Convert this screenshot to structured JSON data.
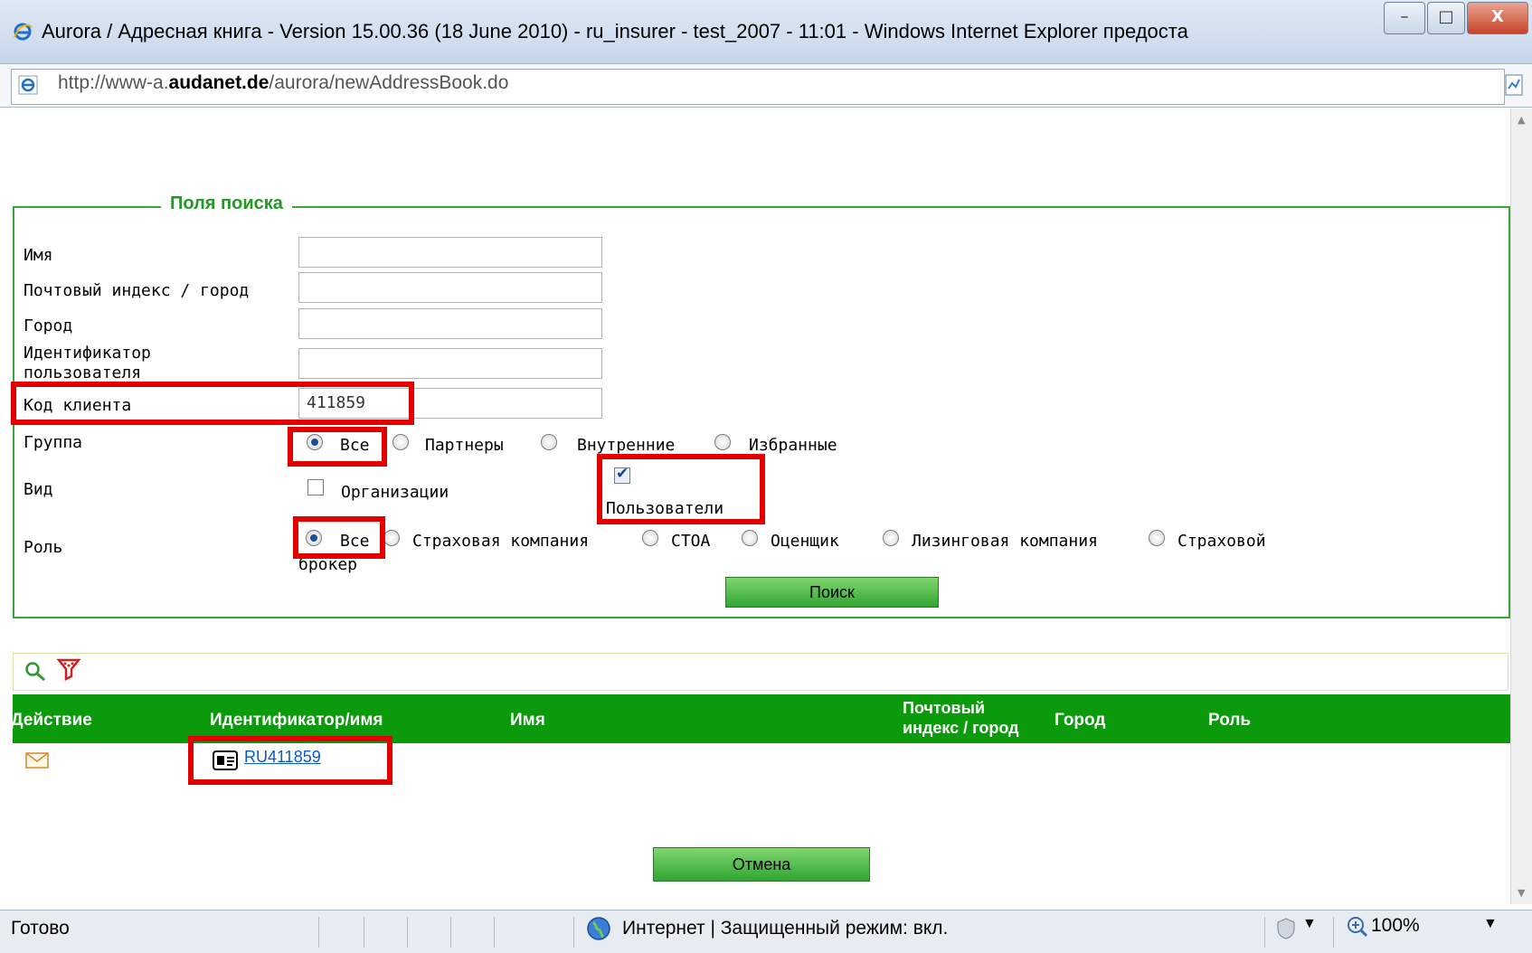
{
  "window": {
    "title": "Aurora / Адресная книга - Version 15.00.36 (18 June 2010) - ru_insurer - test_2007 - 11:01 - Windows Internet Explorer предоста",
    "minimize_label": "–",
    "maximize_label": "□",
    "close_label": "X"
  },
  "address": {
    "url_prefix": "http://www-a.",
    "url_domain": "audanet.de",
    "url_path": "/aurora/newAddressBook.do"
  },
  "search": {
    "legend": "Поля поиска",
    "name_label": "Имя",
    "name_value": "",
    "postal_label": "Почтовый индекс / город",
    "postal_value": "",
    "city_label": "Город",
    "city_value": "",
    "userid_label_line1": "Идентификатор",
    "userid_label_line2": "пользователя",
    "userid_value": "",
    "client_code_label": "Код клиента",
    "client_code_value": "411859",
    "group_label": "Группа",
    "group_options": [
      "Все",
      "Партнеры",
      "Внутренние",
      "Избранные"
    ],
    "group_selected": "Все",
    "type_label": "Вид",
    "type_org_label": "Организации",
    "type_org_checked": false,
    "type_users_label": "Пользователи",
    "type_users_checked": true,
    "role_label": "Роль",
    "role_options": [
      "Все",
      "Страховая компания",
      "СТОА",
      "Оценщик",
      "Лизинговая компания",
      "Страховой"
    ],
    "role_option_wrap": "брокер",
    "role_selected": "Все",
    "search_button": "Поиск"
  },
  "results": {
    "columns": {
      "action": "Действие",
      "id_name": "Идентификатор/имя",
      "name": "Имя",
      "postal_line1": "Почтовый",
      "postal_line2": "индекс / город",
      "city": "Город",
      "role": "Роль"
    },
    "rows": [
      {
        "id": "RU411859"
      }
    ],
    "cancel_button": "Отмена"
  },
  "status": {
    "ready": "Готово",
    "zone": "Интернет | Защищенный режим: вкл.",
    "zoom": "100%"
  }
}
